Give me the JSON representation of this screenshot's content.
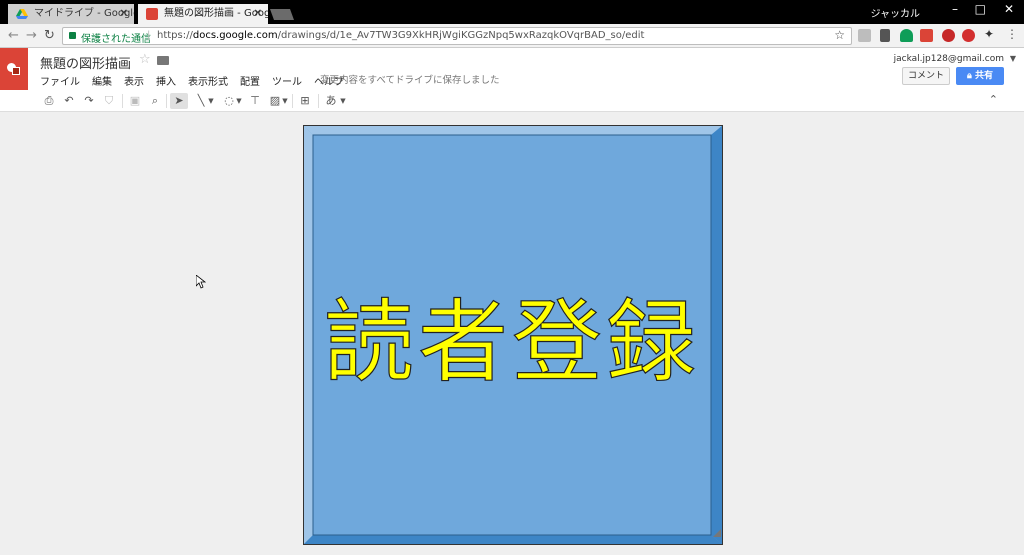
{
  "browser": {
    "tabs": [
      {
        "title": "マイドライブ - Google ドライ",
        "active": false
      },
      {
        "title": "無題の図形描画 - Google",
        "active": true
      }
    ],
    "profile_name": "ジャッカル",
    "security_label": "保護された通信",
    "url": {
      "scheme": "https://",
      "host": "docs.google.com",
      "path": "/drawings/d/1e_Av7TW3G9XkHRjWgiKGGzNpq5wxRazqkOVqrBAD_so/edit"
    }
  },
  "app": {
    "doc_title": "無題の図形描画",
    "menus": [
      "ファイル",
      "編集",
      "表示",
      "挿入",
      "表示形式",
      "配置",
      "ツール",
      "ヘルプ"
    ],
    "save_status": "変更内容をすべてドライブに保存しました",
    "account_email": "jackal.jp128@gmail.com",
    "comment_label": "コメント",
    "share_label": "共有",
    "text_tool_label": "あ"
  },
  "canvas": {
    "shape_text": "読者登録",
    "colors": {
      "shape_face": "#6fa8dc",
      "shape_light": "#9fc5e8",
      "shape_dark": "#3d85c6",
      "text_fill": "#ffff00",
      "app_accent": "#db4437",
      "share_blue": "#4a8af4"
    }
  }
}
